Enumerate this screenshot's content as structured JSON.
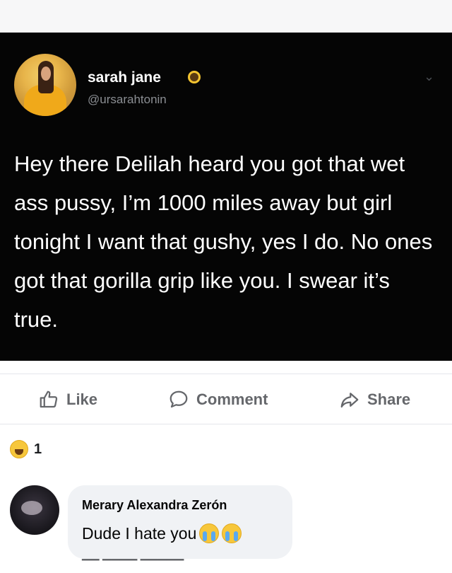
{
  "tweet": {
    "author_name": "sarah jane",
    "handle": "@ursarahtonin",
    "text": "Hey there Delilah heard you got that wet ass pussy, I’m 1000 miles away but girl tonight I want that gushy, yes I do. No ones got that gorilla grip like you. I swear it’s true.",
    "emoji_icon": "sunflower-icon"
  },
  "actions": {
    "like_label": "Like",
    "comment_label": "Comment",
    "share_label": "Share"
  },
  "reactions": {
    "icon": "haha-icon",
    "count": "1"
  },
  "comment": {
    "author": "Merary Alexandra Zerón",
    "text": "Dude I hate you",
    "emoji_icons": [
      "crying-face-icon",
      "crying-face-icon"
    ]
  },
  "colors": {
    "tweet_bg": "#050505",
    "muted": "#65676b",
    "bubble": "#f0f2f5"
  }
}
